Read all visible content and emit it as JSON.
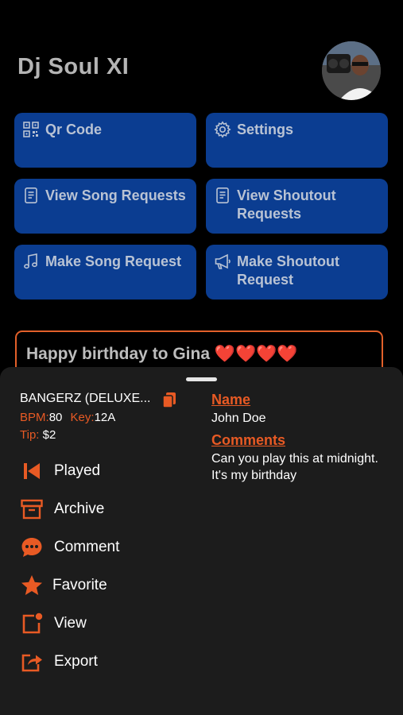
{
  "header": {
    "title": "Dj Soul XI"
  },
  "tiles": {
    "qr": "Qr Code",
    "settings": "Settings",
    "song_requests": "View Song Requests",
    "shoutout_requests_1": "View Shoutout",
    "shoutout_requests_2": "Requests",
    "make_song": "Make Song Request",
    "make_shoutout_1": "Make Shoutout",
    "make_shoutout_2": "Request"
  },
  "message": {
    "text": "Happy birthday to Gina ❤️❤️❤️❤️"
  },
  "sheet": {
    "song_title": "BANGERZ (DELUXE...",
    "bpm_label": "BPM:",
    "bpm_value": "80",
    "key_label": "Key:",
    "key_value": "12A",
    "tip_label": "Tip:",
    "tip_value": "$2",
    "name_header": "Name",
    "name_value": "John Doe",
    "comments_header": "Comments",
    "comments_value": "Can you play this at midnight. It's my birthday",
    "actions": [
      "Played",
      "Archive",
      "Comment",
      "Favorite",
      "View",
      "Export"
    ]
  },
  "colors": {
    "accent": "#e85a24",
    "tile": "#0b3d91",
    "sheet": "#1c1c1c"
  },
  "icons": [
    "qr-code-icon",
    "gear-icon",
    "document-icon",
    "document-icon",
    "music-note-icon",
    "megaphone-icon",
    "copy-icon",
    "skip-back-icon",
    "archive-box-icon",
    "chat-bubble-icon",
    "star-icon",
    "notification-square-icon",
    "export-icon"
  ]
}
